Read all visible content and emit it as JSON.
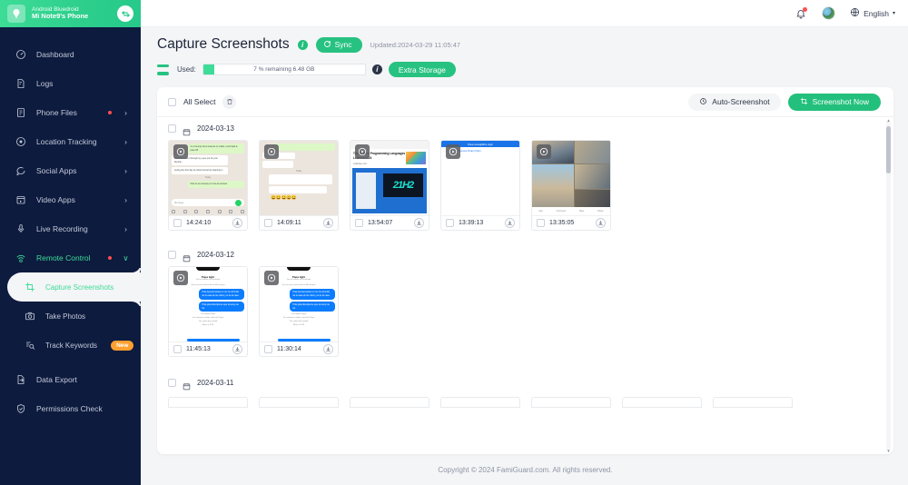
{
  "sidebar": {
    "device": {
      "os_label": "Android Bluedroid",
      "device_name": "Mi Note9's Phone",
      "avatar_icon": "tree-avatar-icon",
      "switch_icon": "switch-device-icon"
    },
    "items": [
      {
        "label": "Dashboard",
        "icon": "dashboard-gauge-icon",
        "chevron": "",
        "dot": false
      },
      {
        "label": "Logs",
        "icon": "logs-document-icon",
        "chevron": "",
        "dot": false
      },
      {
        "label": "Phone Files",
        "icon": "phone-files-clipboard-icon",
        "chevron": "›",
        "dot": true
      },
      {
        "label": "Location Tracking",
        "icon": "location-target-icon",
        "chevron": "›",
        "dot": false
      },
      {
        "label": "Social Apps",
        "icon": "chat-bubble-icon",
        "chevron": "›",
        "dot": false
      },
      {
        "label": "Video Apps",
        "icon": "video-player-icon",
        "chevron": "›",
        "dot": false
      },
      {
        "label": "Live Recording",
        "icon": "microphone-icon",
        "chevron": "›",
        "dot": false
      },
      {
        "label": "Remote Control",
        "icon": "remote-control-icon",
        "chevron": "∨",
        "dot": true,
        "active": true
      }
    ],
    "subitems": [
      {
        "label": "Capture Screenshots",
        "icon": "crop-screenshot-icon",
        "current": true,
        "badge": ""
      },
      {
        "label": "Take Photos",
        "icon": "camera-icon",
        "current": false,
        "badge": ""
      },
      {
        "label": "Track Keywords",
        "icon": "keyword-search-icon",
        "current": false,
        "badge": "New"
      }
    ],
    "bottom_items": [
      {
        "label": "Data Export",
        "icon": "export-file-icon"
      },
      {
        "label": "Permissions Check",
        "icon": "shield-check-icon"
      }
    ]
  },
  "topbar": {
    "bell_icon": "notification-bell-icon",
    "avatar_icon": "user-avatar",
    "globe_icon": "globe-icon",
    "language": "English",
    "caret": "▾"
  },
  "header": {
    "title": "Capture Screenshots",
    "info_icon": "info-icon",
    "sync_label": "Sync",
    "sync_icon": "refresh-icon",
    "updated_text": "Updated:2024-03-29 11:05:47"
  },
  "storage": {
    "icon": "storage-bars-icon",
    "used_label": "Used:",
    "bar_text": "7 % remaining 6.48 GB",
    "used_percent": 7,
    "info_icon": "info-icon",
    "extra_label": "Extra Storage"
  },
  "toolbar": {
    "all_select_label": "All Select",
    "trash_icon": "trash-icon",
    "auto_label": "Auto-Screenshot",
    "auto_icon": "auto-screenshot-icon",
    "now_label": "Screenshot Now",
    "now_icon": "crop-screenshot-icon"
  },
  "groups": [
    {
      "date": "2024-03-13",
      "calendar_icon": "calendar-icon",
      "items": [
        {
          "time": "14:24:10",
          "kind": "whatsapp",
          "download_icon": "download-icon",
          "play_icon": "play-overlay-icon"
        },
        {
          "time": "14:09:11",
          "kind": "whatsapp2",
          "download_icon": "download-icon",
          "play_icon": "play-overlay-icon"
        },
        {
          "time": "13:54:07",
          "kind": "youtube",
          "download_icon": "download-icon",
          "play_icon": "play-overlay-icon"
        },
        {
          "time": "13:39:13",
          "kind": "chrome",
          "download_icon": "download-icon",
          "play_icon": "play-overlay-icon"
        },
        {
          "time": "13:35:05",
          "kind": "photogrid",
          "download_icon": "download-icon",
          "play_icon": "play-overlay-icon"
        }
      ]
    },
    {
      "date": "2024-03-12",
      "calendar_icon": "calendar-icon",
      "items": [
        {
          "time": "11:45:13",
          "kind": "messenger",
          "download_icon": "download-icon",
          "play_icon": "play-overlay-icon"
        },
        {
          "time": "11:30:14",
          "kind": "messenger",
          "download_icon": "download-icon",
          "play_icon": "play-overlay-icon"
        }
      ]
    },
    {
      "date": "2024-03-11",
      "calendar_icon": "calendar-icon",
      "items": []
    }
  ],
  "thumb_content": {
    "youtube": {
      "title": "Top 20 Best Programming Languages To Learn in 2024",
      "meta": "mapbase.com",
      "screen_text": "21H2"
    },
    "chrome": {
      "banner": "Pasa rescajidifire login",
      "link_line": "Termo of Service Privacy Policy"
    },
    "messenger": {
      "name": "Papa light",
      "subtitle": "You're friends on Facebook",
      "note": "You are now connected on Messenger",
      "msg1": "Hola buenas tardes no me he dormido de la casa de los niños y el de la casa",
      "msg2": "Hola grás discúlpeme que tal estoy de ha",
      "footer1": "You added Papa",
      "footer2": "You showed a video chat with Papa",
      "footer3": "The video that ended",
      "footer4": "More at 3:59"
    },
    "whatsapp": {
      "out1": "mi el tiempo de la casa de tu madre o principal te pase 86",
      "in1": "God will make it through my eyes out for your favorite",
      "in2": "touring the first day at school tomorrow cleaning in",
      "stamp": "Today",
      "out2": "tfhis de la semana por toca la semana",
      "placeholder": "Message"
    },
    "photogrid": {
      "actions": [
        "Like",
        "Comment",
        "Save",
        "Share"
      ]
    }
  },
  "footer": {
    "text": "Copyright © 2024 FamiGuard.com. All rights reserved."
  },
  "scrollbar": {
    "up_icon": "scroll-up-arrow-icon",
    "down_icon": "scroll-down-arrow-icon",
    "thumb": "scroll-thumb"
  }
}
